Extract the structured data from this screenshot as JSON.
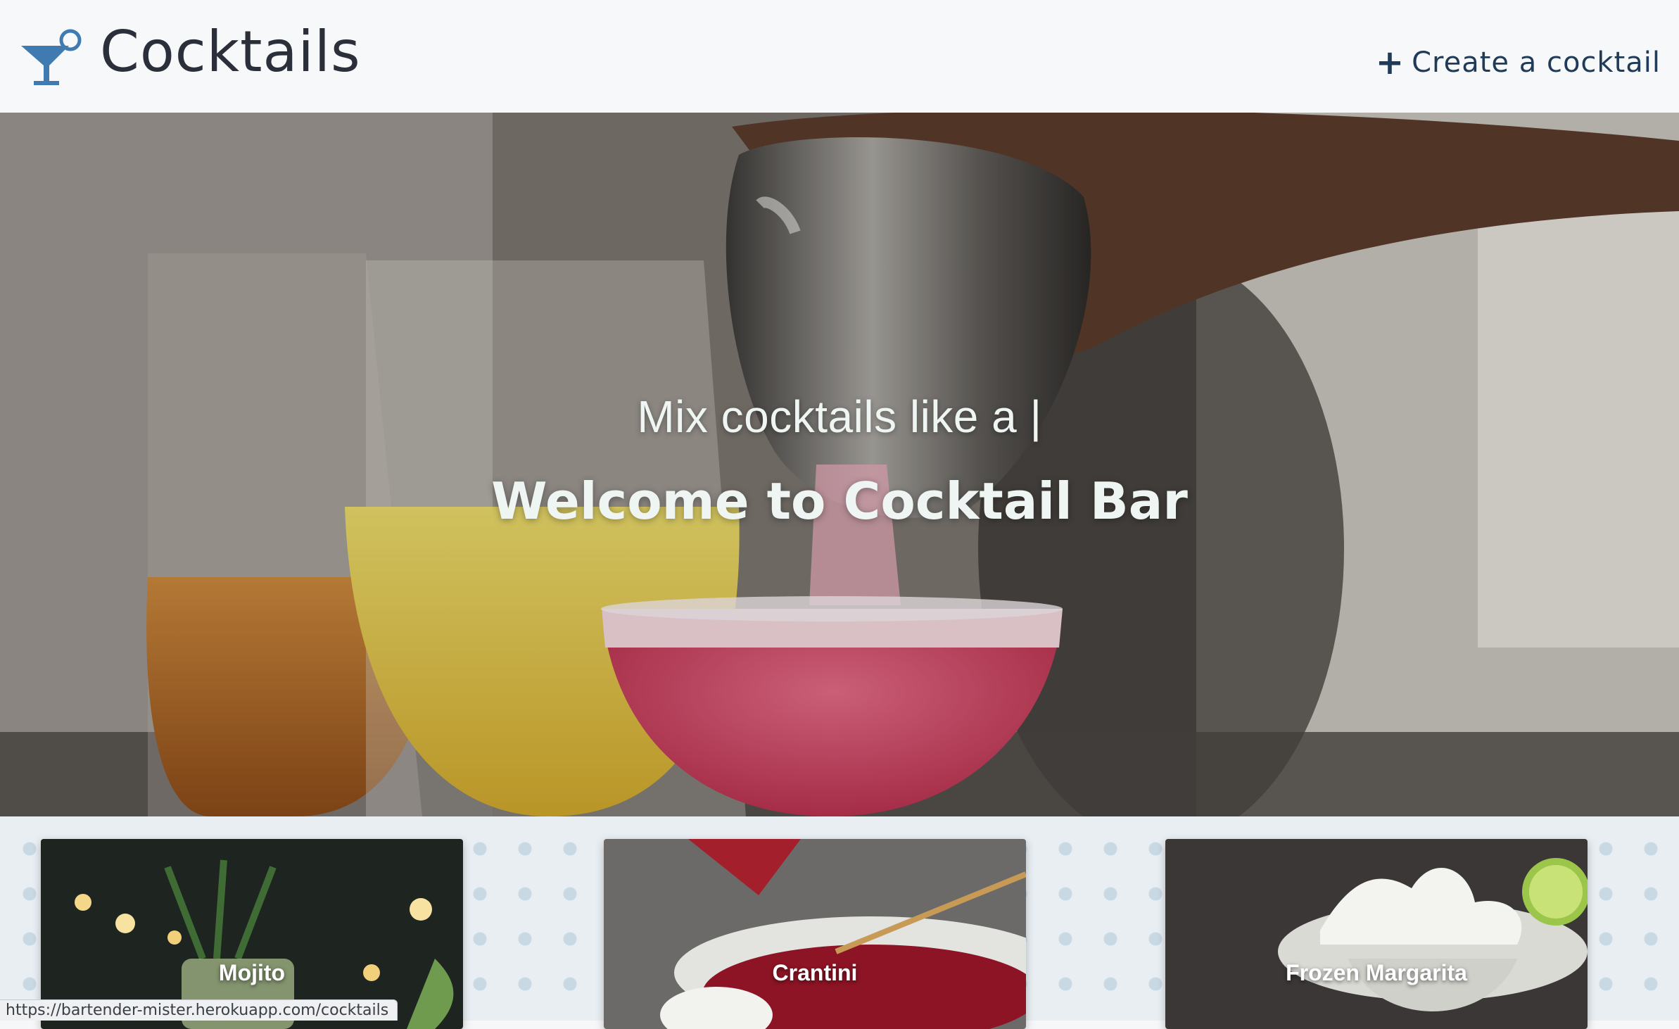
{
  "header": {
    "brand_title": "Cocktails",
    "brand_icon": "cocktail-glass-icon",
    "create_label": "Create a cocktail",
    "create_icon": "plus-icon",
    "accent_color": "#3f7ab0"
  },
  "hero": {
    "subtitle": "Mix cocktails like a |",
    "title": "Welcome to Cocktail Bar"
  },
  "cards": [
    {
      "label": "Mojito"
    },
    {
      "label": "Crantini"
    },
    {
      "label": "Frozen Margarita"
    }
  ],
  "status_bar": {
    "url": "https://bartender-mister.herokuapp.com/cocktails"
  }
}
